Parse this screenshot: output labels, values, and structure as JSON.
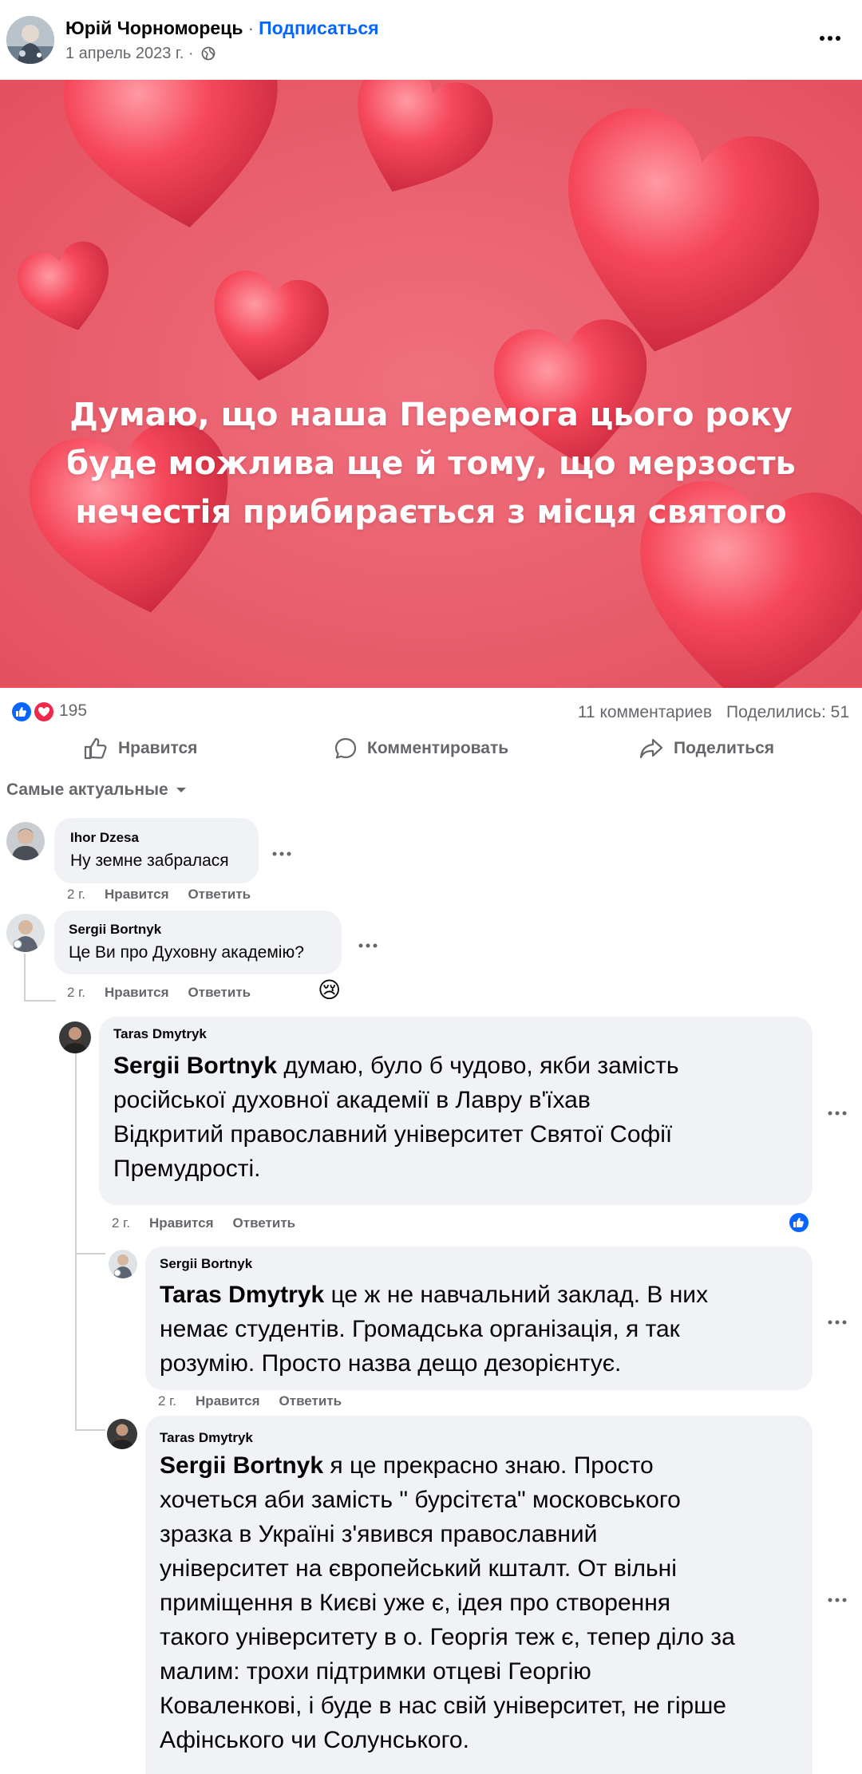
{
  "post": {
    "author": "Юрій Чорноморець",
    "follow_label": "Подписаться",
    "date": "1 апрель 2023 г.",
    "image_text": "Думаю, що наша Перемога цього року буде можлива ще й тому, що мерзость нечестія прибирається з місця святого"
  },
  "stats": {
    "reactions_count": "195",
    "comments": "11 комментариев",
    "shares": "Поделились: 51"
  },
  "actions": {
    "like": "Нравится",
    "comment": "Комментировать",
    "share": "Поделиться"
  },
  "sort_label": "Самые актуальные",
  "comments": [
    {
      "name": "Ihor Dzesa",
      "text": "Ну земне забралася",
      "time": "2 г.",
      "like": "Нравится",
      "reply": "Ответить"
    },
    {
      "name": "Sergii Bortnyk",
      "text": "Це Ви про Духовну академію?",
      "time": "2 г.",
      "like": "Нравится",
      "reply": "Ответить",
      "reaction": "😢"
    },
    {
      "name": "Taras Dmytryk",
      "mention": "Sergii Bortnyk",
      "line1": " думаю, було б чудово, якби замість",
      "line2": "російської духовної академії в Лавру в'їхав",
      "line3": "Відкритий православний університет Святої Софії",
      "line4": "Премудрості.",
      "time": "2 г.",
      "like": "Нравится",
      "reply": "Ответить"
    },
    {
      "name": "Sergii Bortnyk",
      "mention": "Taras Dmytryk",
      "line1": " це ж не навчальний заклад. В них",
      "line2": "немає студентів. Громадська організація, я так",
      "line3": "розумію. Просто назва дещо дезорієнтує.",
      "time": "2 г.",
      "like": "Нравится",
      "reply": "Ответить"
    },
    {
      "name": "Taras Dmytryk",
      "mention": "Sergii Bortnyk",
      "line1": " я це прекрасно знаю. Просто",
      "line2": "хочеться аби замість \" бурсітєта\" московського",
      "line3": "зразка в Україні з'явився православний",
      "line4": "університет на європейський кшталт. От вільні",
      "line5": "приміщення в Києві уже є, ідея про створення",
      "line6": "такого університету в о. Георгія теж є, тепер діло за",
      "line7": "малим: трохи підтримки отцеві Георгію",
      "line8": "Коваленкові, і буде в нас свій університет, не гірше",
      "line9": "Афінського чи Солунського."
    }
  ],
  "colors": {
    "facebook_blue": "#0866ff",
    "heart_red": "#f02849",
    "image_bg": "#ec5c6c",
    "bubble_bg": "#f0f2f5",
    "meta_gray": "#65676b"
  }
}
